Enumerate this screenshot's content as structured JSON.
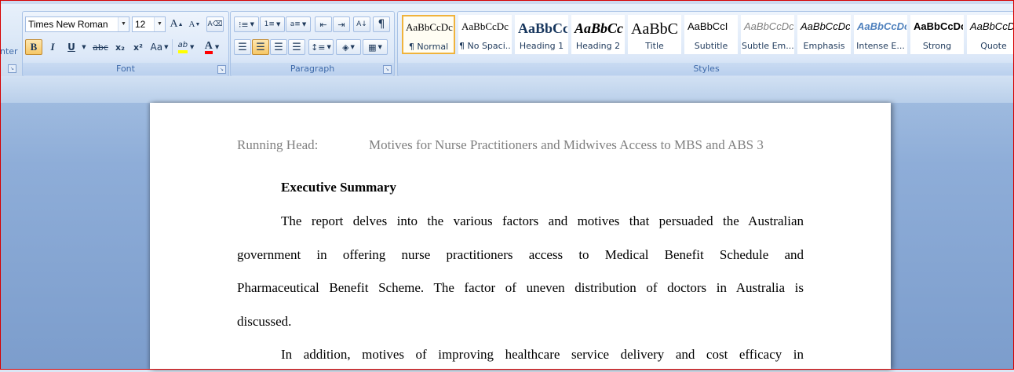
{
  "clipboard": {
    "partial_label": "nter"
  },
  "font_group": {
    "label": "Font",
    "font_name": "Times New Roman",
    "font_size": "12",
    "grow_font": "A",
    "shrink_font": "A",
    "bold": "B",
    "italic": "I",
    "underline": "U",
    "strikethrough": "abc",
    "subscript": "x₂",
    "superscript": "x²",
    "change_case": "Aa",
    "highlight_text": "ab",
    "font_color": "A"
  },
  "paragraph_group": {
    "label": "Paragraph",
    "pilcrow": "¶"
  },
  "styles_group": {
    "label": "Styles",
    "tiles": [
      {
        "sample": "AaBbCcDc",
        "name": "¶ Normal"
      },
      {
        "sample": "AaBbCcDc",
        "name": "¶ No Spaci..."
      },
      {
        "sample": "AaBbCc",
        "name": "Heading 1"
      },
      {
        "sample": "AaBbCc",
        "name": "Heading 2"
      },
      {
        "sample": "AaBbC",
        "name": "Title"
      },
      {
        "sample": "AaBbCcI",
        "name": "Subtitle"
      },
      {
        "sample": "AaBbCcDc",
        "name": "Subtle Em..."
      },
      {
        "sample": "AaBbCcDc",
        "name": "Emphasis"
      },
      {
        "sample": "AaBbCcDc",
        "name": "Intense E..."
      },
      {
        "sample": "AaBbCcDc",
        "name": "Strong"
      },
      {
        "sample": "AaBbCcDc",
        "name": "Quote"
      }
    ]
  },
  "document": {
    "header_left": "Running Head:",
    "header_right": "Motives for Nurse Practitioners and Midwives Access to MBS and ABS 3",
    "heading": "Executive Summary",
    "para1_lines": [
      "The report delves into the various factors and motives that persuaded the Australian",
      "government in offering nurse practitioners access to Medical Benefit Schedule and",
      "Pharmaceutical Benefit Scheme. The factor of uneven distribution of doctors in Australia is",
      "discussed."
    ],
    "para2_lines": [
      "In addition, motives of improving healthcare service delivery and cost efficacy in"
    ]
  },
  "colors": {
    "highlight": "#ffff00",
    "font_color": "#ff0000",
    "accent": "#3e6aaa"
  }
}
